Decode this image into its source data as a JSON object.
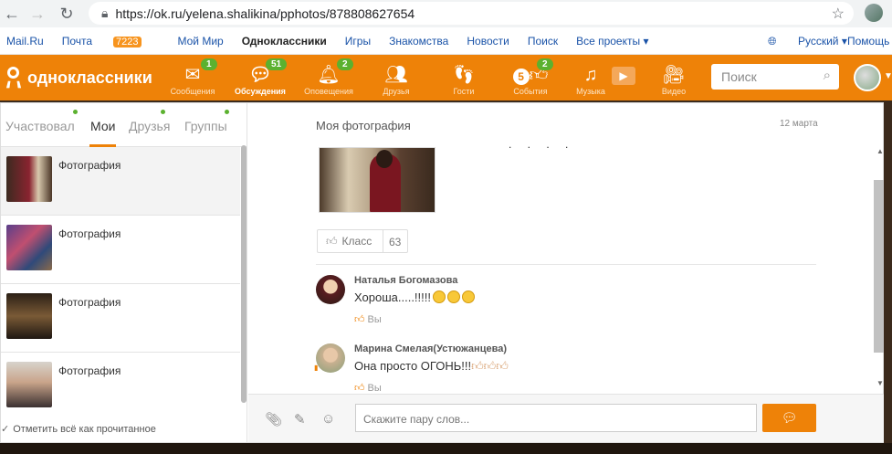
{
  "browser": {
    "url": "https://ok.ru/yelena.shalikina/pphotos/878808627654"
  },
  "portal": {
    "links": [
      "Mail.Ru",
      "Почта",
      "Мой Мир",
      "Одноклассники",
      "Игры",
      "Знакомства",
      "Новости",
      "Поиск",
      "Все проекты ▾"
    ],
    "mail_count": "7223",
    "language": "Русский ▾",
    "help": "Помощь"
  },
  "ok_header": {
    "logo_text": "одноклассники",
    "nav": [
      {
        "label": "Сообщения",
        "badge": "1",
        "icon": "envelope-icon"
      },
      {
        "label": "Обсуждения",
        "badge": "51",
        "icon": "chat-bubbles-icon"
      },
      {
        "label": "Оповещения",
        "badge": "2",
        "icon": "bell-icon"
      },
      {
        "label": "Друзья",
        "badge": "",
        "icon": "people-icon"
      },
      {
        "label": "Гости",
        "badge": "",
        "icon": "footprints-icon"
      },
      {
        "label": "События",
        "badge": "2",
        "icon": "events-icon",
        "events_num": "5"
      },
      {
        "label": "Музыка",
        "badge": "",
        "icon": "music-note-icon"
      },
      {
        "label": "Видео",
        "badge": "",
        "icon": "video-camera-icon"
      }
    ],
    "search_placeholder": "Поиск"
  },
  "discussions": {
    "tabs": [
      "Участвовал",
      "Мои",
      "Друзья",
      "Группы"
    ],
    "active_tab": "Мои",
    "items": [
      {
        "label": "Фотография"
      },
      {
        "label": "Фотография"
      },
      {
        "label": "Фотография"
      },
      {
        "label": "Фотография"
      }
    ],
    "mark_all_read": "Отметить всё как прочитанное"
  },
  "post": {
    "title": "Моя фотография",
    "date": "12 марта",
    "dots": ". . . .",
    "like_label": "Класс",
    "like_count": "63"
  },
  "comments": [
    {
      "author": "Наталья Богомазова",
      "text": "Хороша.....!!!!!",
      "smileys": 3,
      "like_label": "Вы"
    },
    {
      "author": "Марина Смелая(Устюжанцева)",
      "text": "Она просто ОГОНЬ!!!",
      "thumbs": 3,
      "like_label": "Вы"
    }
  ],
  "composer": {
    "placeholder": "Скажите пару слов..."
  },
  "colors": {
    "brand_orange": "#ee8208",
    "badge_green": "#5bb12f",
    "link_blue": "#1a53a8"
  }
}
